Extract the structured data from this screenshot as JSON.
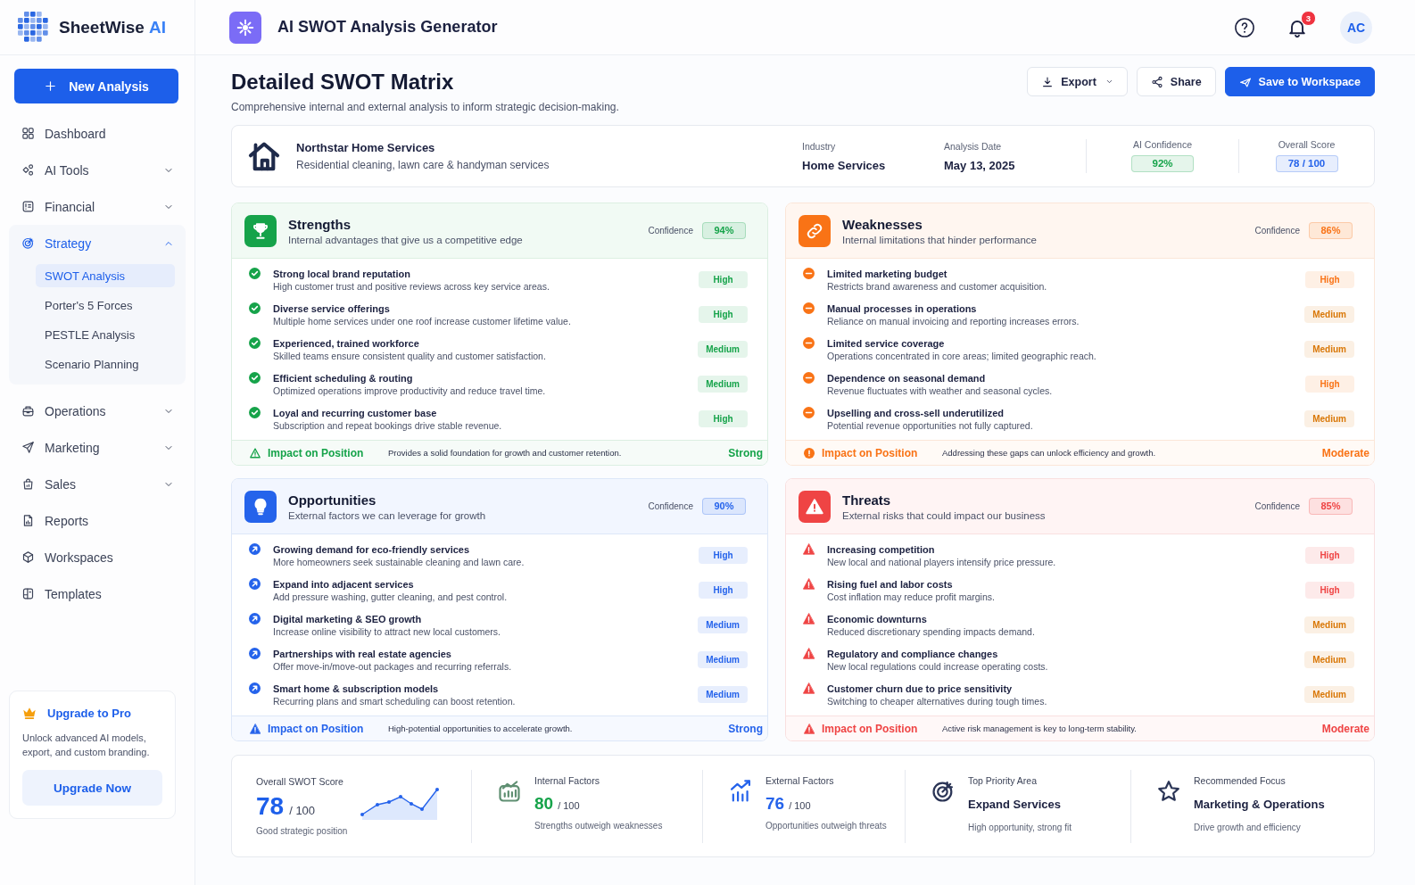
{
  "app": {
    "name": "SheetWise",
    "name_accent": "AI"
  },
  "sidebar": {
    "new_button": "New Analysis",
    "nav": [
      {
        "label": "Dashboard",
        "kind": "link",
        "selected": false
      },
      {
        "label": "AI Tools",
        "kind": "group",
        "expanded": false,
        "selected": false
      },
      {
        "label": "Financial",
        "kind": "group",
        "expanded": false,
        "selected": false
      },
      {
        "label": "Strategy",
        "kind": "group",
        "expanded": true,
        "selected": true,
        "children": [
          {
            "label": "SWOT Analysis",
            "selected": true
          },
          {
            "label": "Porter's 5 Forces",
            "selected": false
          },
          {
            "label": "PESTLE Analysis",
            "selected": false
          },
          {
            "label": "Scenario Planning",
            "selected": false
          }
        ]
      },
      {
        "label": "Operations",
        "kind": "group",
        "expanded": false,
        "selected": false
      },
      {
        "label": "Marketing",
        "kind": "group",
        "expanded": false,
        "selected": false
      },
      {
        "label": "Sales",
        "kind": "group",
        "expanded": false,
        "selected": false
      },
      {
        "label": "Reports",
        "kind": "link",
        "selected": false
      },
      {
        "label": "Workspaces",
        "kind": "link",
        "selected": false
      },
      {
        "label": "Templates",
        "kind": "link",
        "selected": false
      }
    ],
    "upgrade": {
      "title": "Upgrade to Pro",
      "text": "Unlock advanced AI models, export, and custom branding.",
      "button": "Upgrade Now"
    }
  },
  "header": {
    "title": "AI SWOT Analysis Generator",
    "notifications": "3",
    "avatar": "AC"
  },
  "page": {
    "title": "Detailed SWOT Matrix",
    "subtitle": "Comprehensive internal and external analysis to inform strategic decision-making.",
    "actions": [
      {
        "label": "Export",
        "kind": "menu"
      },
      {
        "label": "Share",
        "kind": "share"
      },
      {
        "label": "Save to Workspace",
        "kind": "primary"
      }
    ]
  },
  "company": {
    "name": "Northstar Home Services",
    "description": "Residential cleaning, lawn care & handyman services",
    "facts": [
      {
        "label": "Industry",
        "value": "Home Services"
      },
      {
        "label": "Analysis Date",
        "value": "May 13, 2025"
      }
    ],
    "metrics": [
      {
        "label": "AI Confidence",
        "value": "92%",
        "color": "#16a34a"
      },
      {
        "label": "Overall Score",
        "value": "78 / 100",
        "color": "#2563eb"
      }
    ]
  },
  "quadrants": [
    {
      "kind": "strengths",
      "title": "Strengths",
      "subtitle": "Internal advantages that give us a competitive edge",
      "confidence_label": "Confidence",
      "confidence": "94%",
      "items": [
        {
          "title": "Strong local brand reputation",
          "text": "High customer trust and positive reviews across key service areas.",
          "priority": "High",
          "color": "#16a34a"
        },
        {
          "title": "Diverse service offerings",
          "text": "Multiple home services under one roof increase customer lifetime value.",
          "priority": "High",
          "color": "#16a34a"
        },
        {
          "title": "Experienced, trained workforce",
          "text": "Skilled teams ensure consistent quality and customer satisfaction.",
          "priority": "Medium",
          "color": "#16a34a"
        },
        {
          "title": "Efficient scheduling & routing",
          "text": "Optimized operations improve productivity and reduce travel time.",
          "priority": "Medium",
          "color": "#16a34a"
        },
        {
          "title": "Loyal and recurring customer base",
          "text": "Subscription and repeat bookings drive stable revenue.",
          "priority": "High",
          "color": "#16a34a"
        }
      ],
      "impact": {
        "label": "Impact on Position",
        "text": "Provides a solid foundation for growth and customer retention.",
        "rating": "Strong"
      }
    },
    {
      "kind": "weaknesses",
      "title": "Weaknesses",
      "subtitle": "Internal limitations that hinder performance",
      "confidence_label": "Confidence",
      "confidence": "86%",
      "items": [
        {
          "title": "Limited marketing budget",
          "text": "Restricts brand awareness and customer acquisition.",
          "priority": "High",
          "color": "#f97316"
        },
        {
          "title": "Manual processes in operations",
          "text": "Reliance on manual invoicing and reporting increases errors.",
          "priority": "Medium",
          "color": "#d97706"
        },
        {
          "title": "Limited service coverage",
          "text": "Operations concentrated in core areas; limited geographic reach.",
          "priority": "Medium",
          "color": "#d97706"
        },
        {
          "title": "Dependence on seasonal demand",
          "text": "Revenue fluctuates with weather and seasonal cycles.",
          "priority": "High",
          "color": "#f97316"
        },
        {
          "title": "Upselling and cross-sell underutilized",
          "text": "Potential revenue opportunities not fully captured.",
          "priority": "Medium",
          "color": "#d97706"
        }
      ],
      "impact": {
        "label": "Impact on Position",
        "text": "Addressing these gaps can unlock efficiency and growth.",
        "rating": "Moderate"
      }
    },
    {
      "kind": "opportunities",
      "title": "Opportunities",
      "subtitle": "External factors we can leverage for growth",
      "confidence_label": "Confidence",
      "confidence": "90%",
      "items": [
        {
          "title": "Growing demand for eco-friendly services",
          "text": "More homeowners seek sustainable cleaning and lawn care.",
          "priority": "High",
          "color": "#2563eb"
        },
        {
          "title": "Expand into adjacent services",
          "text": "Add pressure washing, gutter cleaning, and pest control.",
          "priority": "High",
          "color": "#2563eb"
        },
        {
          "title": "Digital marketing & SEO growth",
          "text": "Increase online visibility to attract new local customers.",
          "priority": "Medium",
          "color": "#2563eb"
        },
        {
          "title": "Partnerships with real estate agencies",
          "text": "Offer move-in/move-out packages and recurring referrals.",
          "priority": "Medium",
          "color": "#2563eb"
        },
        {
          "title": "Smart home & subscription models",
          "text": "Recurring plans and smart scheduling can boost retention.",
          "priority": "Medium",
          "color": "#2563eb"
        }
      ],
      "impact": {
        "label": "Impact on Position",
        "text": "High-potential opportunities to accelerate growth.",
        "rating": "Strong"
      }
    },
    {
      "kind": "threats",
      "title": "Threats",
      "subtitle": "External risks that could impact our business",
      "confidence_label": "Confidence",
      "confidence": "85%",
      "items": [
        {
          "title": "Increasing competition",
          "text": "New local and national players intensify price pressure.",
          "priority": "High",
          "color": "#ef4444"
        },
        {
          "title": "Rising fuel and labor costs",
          "text": "Cost inflation may reduce profit margins.",
          "priority": "High",
          "color": "#ef4444"
        },
        {
          "title": "Economic downturns",
          "text": "Reduced discretionary spending impacts demand.",
          "priority": "Medium",
          "color": "#d97706"
        },
        {
          "title": "Regulatory and compliance changes",
          "text": "New local regulations could increase operating costs.",
          "priority": "Medium",
          "color": "#d97706"
        },
        {
          "title": "Customer churn due to price sensitivity",
          "text": "Switching to cheaper alternatives during tough times.",
          "priority": "Medium",
          "color": "#d97706"
        }
      ],
      "impact": {
        "label": "Impact on Position",
        "text": "Active risk management is key to long-term stability.",
        "rating": "Moderate"
      }
    }
  ],
  "summary": {
    "overall": {
      "label": "Overall SWOT Score",
      "value": "78",
      "total": "/ 100",
      "caption": "Good strategic position"
    },
    "stats": [
      {
        "kind": "score",
        "label": "Internal Factors",
        "value": "80",
        "total": "/ 100",
        "caption": "Strengths outweigh weaknesses",
        "color": "#16a34a"
      },
      {
        "kind": "score",
        "label": "External Factors",
        "value": "76",
        "total": "/ 100",
        "caption": "Opportunities outweigh threats",
        "color": "#2563eb"
      },
      {
        "kind": "focus",
        "label": "Top Priority Area",
        "value": "Expand Services",
        "caption": "High opportunity, strong fit"
      },
      {
        "kind": "focus",
        "label": "Recommended Focus",
        "value": "Marketing & Operations",
        "caption": "Drive growth and efficiency"
      }
    ]
  }
}
